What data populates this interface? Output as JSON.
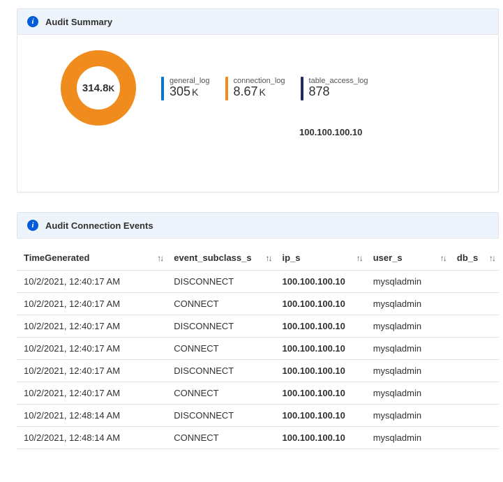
{
  "panels": {
    "summary_title": "Audit Summary",
    "connection_title": "Audit Connection Events"
  },
  "summary": {
    "donut_total": "314.8",
    "donut_unit": "K",
    "metric_general_label": "general_log",
    "metric_general_value": "305",
    "metric_general_unit": "K",
    "metric_connection_label": "connection_log",
    "metric_connection_value": "8.67",
    "metric_connection_unit": "K",
    "metric_table_label": "table_access_log",
    "metric_table_value": "878",
    "metric_table_unit": "",
    "extra_ip": "100.100.100.10"
  },
  "table": {
    "headers": {
      "time": "TimeGenerated",
      "subclass": "event_subclass_s",
      "ip": "ip_s",
      "user": "user_s",
      "db": "db_s"
    },
    "rows": [
      {
        "time": "10/2/2021, 12:40:17 AM",
        "subclass": "DISCONNECT",
        "ip": "100.100.100.10",
        "user": "mysqladmin",
        "db": ""
      },
      {
        "time": "10/2/2021, 12:40:17 AM",
        "subclass": "CONNECT",
        "ip": "100.100.100.10",
        "user": "mysqladmin",
        "db": ""
      },
      {
        "time": "10/2/2021, 12:40:17 AM",
        "subclass": "DISCONNECT",
        "ip": "100.100.100.10",
        "user": "mysqladmin",
        "db": ""
      },
      {
        "time": "10/2/2021, 12:40:17 AM",
        "subclass": "CONNECT",
        "ip": "100.100.100.10",
        "user": "mysqladmin",
        "db": ""
      },
      {
        "time": "10/2/2021, 12:40:17 AM",
        "subclass": "DISCONNECT",
        "ip": "100.100.100.10",
        "user": "mysqladmin",
        "db": ""
      },
      {
        "time": "10/2/2021, 12:40:17 AM",
        "subclass": "CONNECT",
        "ip": "100.100.100.10",
        "user": "mysqladmin",
        "db": ""
      },
      {
        "time": "10/2/2021, 12:48:14 AM",
        "subclass": "DISCONNECT",
        "ip": "100.100.100.10",
        "user": "mysqladmin",
        "db": ""
      },
      {
        "time": "10/2/2021, 12:48:14 AM",
        "subclass": "CONNECT",
        "ip": "100.100.100.10",
        "user": "mysqladmin",
        "db": ""
      }
    ]
  },
  "chart_data": {
    "type": "pie",
    "title": "Audit Summary",
    "series": [
      {
        "name": "general_log",
        "value": 305000,
        "color": "#0078d4"
      },
      {
        "name": "connection_log",
        "value": 8670,
        "color": "#f08b1d"
      },
      {
        "name": "table_access_log",
        "value": 878,
        "color": "#222b5f"
      }
    ],
    "total_display": "314.8K"
  },
  "colors": {
    "accent": "#0078d4",
    "orange": "#f08b1d",
    "dark": "#222b5f",
    "header_bg": "#edf4fb"
  }
}
